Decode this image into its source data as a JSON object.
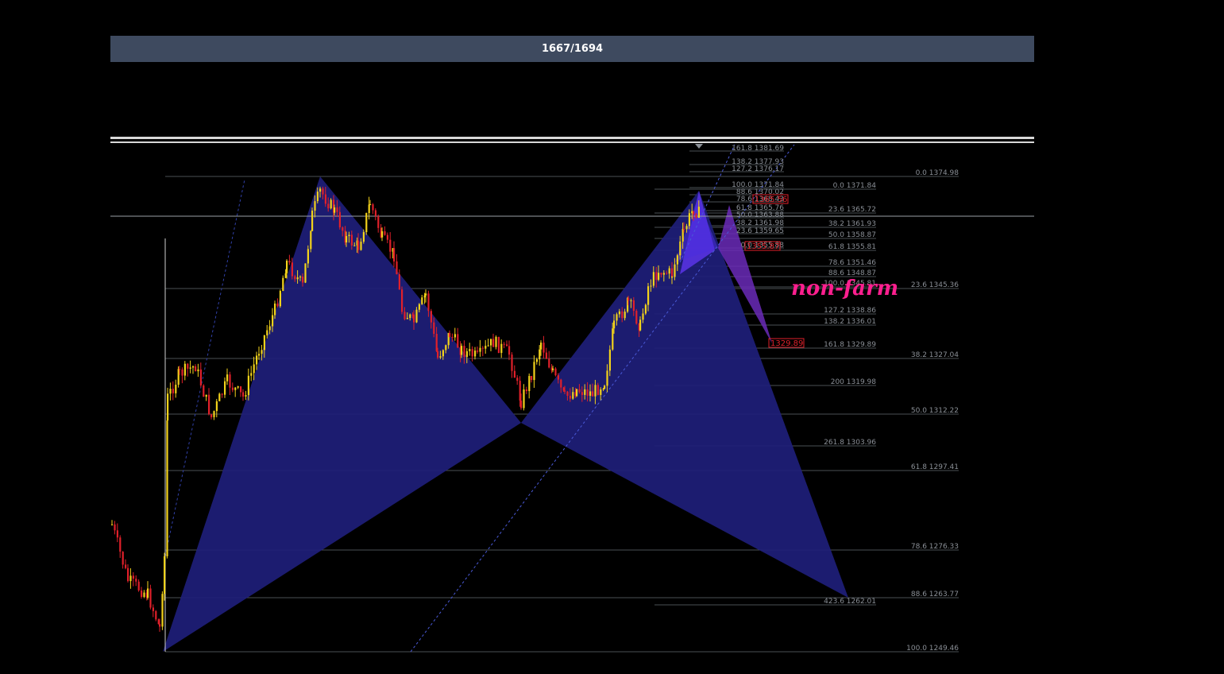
{
  "header": {
    "counter": "1667/1694"
  },
  "watermark": {
    "text": "non-farm",
    "color": "#ff1f8f"
  },
  "colors": {
    "background": "#000000",
    "bull_candle": "#f2d21b",
    "bear_candle": "#e0202a",
    "harmonic_fill": "#1e1e7a",
    "harmonic_inner": "#5a34e8",
    "harmonic_projection": "#6a2ab8",
    "fib_line": "#4a4f55",
    "fib_text": "#8a8f96",
    "alert_red": "#e0202a"
  },
  "fib_levels": {
    "right": [
      {
        "text": "0.0 1374.98"
      },
      {
        "text": "23.6 1345.36"
      },
      {
        "text": "38.2 1327.04"
      },
      {
        "text": "50.0 1312.22"
      },
      {
        "text": "61.8 1297.41"
      },
      {
        "text": "78.6 1276.33"
      },
      {
        "text": "88.6 1263.77"
      },
      {
        "text": "100.0 1249.46"
      }
    ],
    "middle": [
      {
        "text": "0.0 1371.84"
      },
      {
        "text": "23.6 1365.72"
      },
      {
        "text": "38.2 1361.93"
      },
      {
        "text": "50.0 1358.87"
      },
      {
        "text": "61.8 1355.81"
      },
      {
        "text": "78.6 1351.46"
      },
      {
        "text": "88.6 1348.87"
      },
      {
        "text": "100.0 1345.81"
      },
      {
        "text": "127.2 1338.86"
      },
      {
        "text": "138.2 1336.01"
      },
      {
        "text": "161.8 1329.89"
      },
      {
        "text": "200 1319.98"
      },
      {
        "text": "261.8 1303.96"
      },
      {
        "text": "423.6 1262.01"
      }
    ],
    "top": [
      {
        "text": "161.8 1381.69"
      },
      {
        "text": "138.2 1377.93"
      },
      {
        "text": "127.2 1376.17"
      },
      {
        "text": "100.0 1371.84"
      },
      {
        "text": "88.6 1370.02"
      },
      {
        "text": "78.6 1368.43"
      },
      {
        "text": "61.8 1365.76"
      },
      {
        "text": "50.0 1363.88"
      },
      {
        "text": "38.2 1361.98"
      },
      {
        "text": "23.6 1359.65"
      },
      {
        "text": "0.0 1355.88"
      }
    ],
    "alerts": [
      {
        "text": "1365.56"
      },
      {
        "text": "1355.87"
      },
      {
        "text": "1329.89"
      }
    ]
  }
}
